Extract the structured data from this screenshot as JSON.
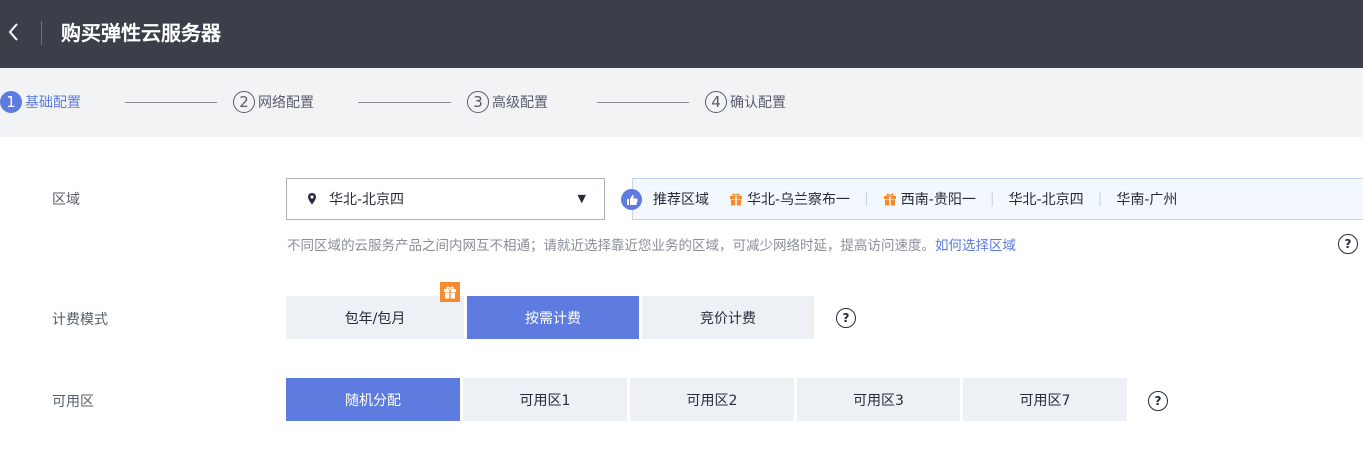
{
  "header": {
    "back_icon": "chevron-left-icon",
    "title": "购买弹性云服务器"
  },
  "steps": [
    {
      "num": "1",
      "label": "基础配置",
      "active": true
    },
    {
      "num": "2",
      "label": "网络配置",
      "active": false
    },
    {
      "num": "3",
      "label": "高级配置",
      "active": false
    },
    {
      "num": "4",
      "label": "确认配置",
      "active": false
    }
  ],
  "region": {
    "label": "区域",
    "selected": "华北-北京四",
    "recommend_title": "推荐区域",
    "recommended": [
      "华北-乌兰察布一",
      "西南-贵阳一",
      "华北-北京四",
      "华南-广州"
    ],
    "hint": "不同区域的云服务产品之间内网互不相通；请就近选择靠近您业务的区域，可减少网络时延，提高访问速度。",
    "hint_link": "如何选择区域"
  },
  "billing": {
    "label": "计费模式",
    "options": [
      "包年/包月",
      "按需计费",
      "竞价计费"
    ],
    "selected": "按需计费"
  },
  "az": {
    "label": "可用区",
    "options": [
      "随机分配",
      "可用区1",
      "可用区2",
      "可用区3",
      "可用区7"
    ],
    "selected": "随机分配"
  },
  "help_symbol": "?",
  "colors": {
    "topbar": "#3a3f49",
    "accent": "#5e7ce0",
    "gift": "#f68b2e"
  }
}
